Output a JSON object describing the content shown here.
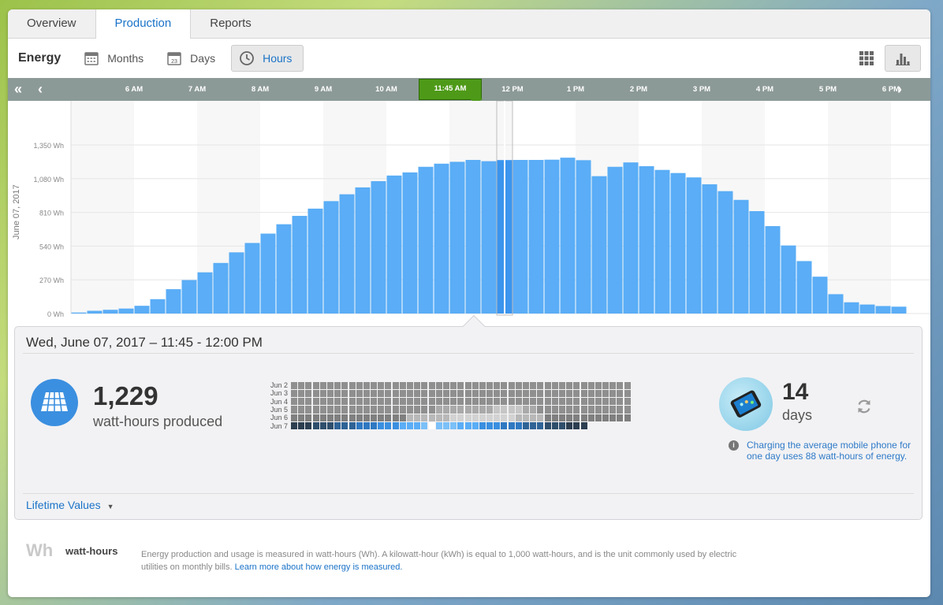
{
  "tabs": [
    {
      "label": "Overview",
      "active": false
    },
    {
      "label": "Production",
      "active": true
    },
    {
      "label": "Reports",
      "active": false
    }
  ],
  "toolbar": {
    "title": "Energy",
    "periods": [
      {
        "label": "Months",
        "icon": "calendar-icon"
      },
      {
        "label": "Days",
        "icon": "calendar-23-icon",
        "day_number": "23"
      },
      {
        "label": "Hours",
        "icon": "clock-icon",
        "active": true
      }
    ]
  },
  "timebar": {
    "hours": [
      "6 AM",
      "7 AM",
      "8 AM",
      "9 AM",
      "10 AM",
      "12 PM",
      "1 PM",
      "2 PM",
      "3 PM",
      "4 PM",
      "5 PM",
      "6 PM"
    ],
    "selected": "11:45 AM",
    "first_icon": "double-chevron-left-icon",
    "prev_icon": "chevron-left-icon",
    "next_icon": "chevron-right-icon"
  },
  "chart_data": {
    "type": "bar",
    "ylabel": "June 07, 2017",
    "ylim": [
      0,
      1350
    ],
    "yticks": [
      "0 Wh",
      "270 Wh",
      "540 Wh",
      "810 Wh",
      "1,080 Wh",
      "1,350 Wh"
    ],
    "grid": true,
    "interval_minutes": 15,
    "first_interval": "5:00 AM",
    "selected_index": 27,
    "values": [
      8,
      22,
      30,
      40,
      62,
      115,
      195,
      268,
      330,
      405,
      490,
      565,
      640,
      715,
      782,
      840,
      900,
      955,
      1010,
      1060,
      1105,
      1130,
      1175,
      1200,
      1215,
      1230,
      1220,
      1229,
      1230,
      1230,
      1232,
      1248,
      1228,
      1100,
      1175,
      1210,
      1180,
      1150,
      1125,
      1090,
      1035,
      980,
      910,
      820,
      700,
      545,
      420,
      295,
      155,
      90,
      72,
      60,
      55
    ],
    "color": "#5aadf6",
    "selected_color": "#3b95ee"
  },
  "panel": {
    "heading": "Wed, June 07, 2017 – 11:45 - 12:00 PM",
    "produced_value": "1,229",
    "produced_label": "watt-hours produced",
    "heatmap_rows": [
      "Jun 2",
      "Jun 3",
      "Jun 4",
      "Jun 5",
      "Jun 6",
      "Jun 7"
    ],
    "days_value": "14",
    "days_label": "days",
    "note": "Charging the average mobile phone for one day uses 88 watt-hours of energy.",
    "lifetime_label": "Lifetime Values"
  },
  "footer": {
    "abbr": "Wh",
    "title": "watt-hours",
    "text": "Energy production and usage is measured in watt-hours (Wh). A kilowatt-hour (kWh) is equal to 1,000 watt-hours, and is the unit commonly used by electric utilities on monthly bills.",
    "link": "Learn more about how energy is measured."
  },
  "colors": {
    "accent": "#1a73c8",
    "bar": "#5aadf6",
    "selected_tab": "#4e9a18",
    "timebar": "#8c9a97"
  }
}
